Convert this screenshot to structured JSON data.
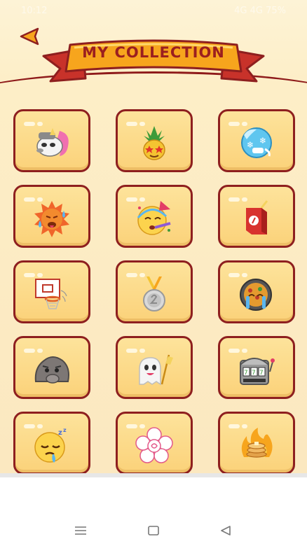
{
  "status_bar": {
    "left_text": "10:12",
    "right_text": "4G 4G 75%"
  },
  "header": {
    "title": "MY COLLECTION",
    "back_icon": "back-arrow-icon"
  },
  "collection": {
    "items": [
      {
        "name": "unicorn-raccoon",
        "icon": "unicorn-icon"
      },
      {
        "name": "pineapple-star-eyes",
        "icon": "pineapple-icon"
      },
      {
        "name": "frozen-face",
        "icon": "ice-face-icon"
      },
      {
        "name": "hot-sun-face",
        "icon": "sun-face-icon"
      },
      {
        "name": "party-face",
        "icon": "party-face-icon"
      },
      {
        "name": "juice-box",
        "icon": "juice-box-icon"
      },
      {
        "name": "basketball-hoop",
        "icon": "basketball-hoop-icon"
      },
      {
        "name": "silver-medal",
        "icon": "medal-icon"
      },
      {
        "name": "crying-pan",
        "icon": "paella-pan-icon"
      },
      {
        "name": "thinking-rock",
        "icon": "rock-icon"
      },
      {
        "name": "ghost-flag",
        "icon": "ghost-icon"
      },
      {
        "name": "slot-machine",
        "icon": "slot-machine-icon"
      },
      {
        "name": "sleepy-face",
        "icon": "sleepy-face-icon"
      },
      {
        "name": "white-flower",
        "icon": "flower-icon"
      },
      {
        "name": "fire-pancakes",
        "icon": "pancakes-icon"
      }
    ]
  },
  "nav": {
    "menu_icon": "menu-icon",
    "home_icon": "home-icon",
    "back_icon": "nav-back-icon"
  },
  "colors": {
    "accent": "#8e1f1f",
    "banner": "#f7a51d",
    "tile": "#fde39b"
  }
}
